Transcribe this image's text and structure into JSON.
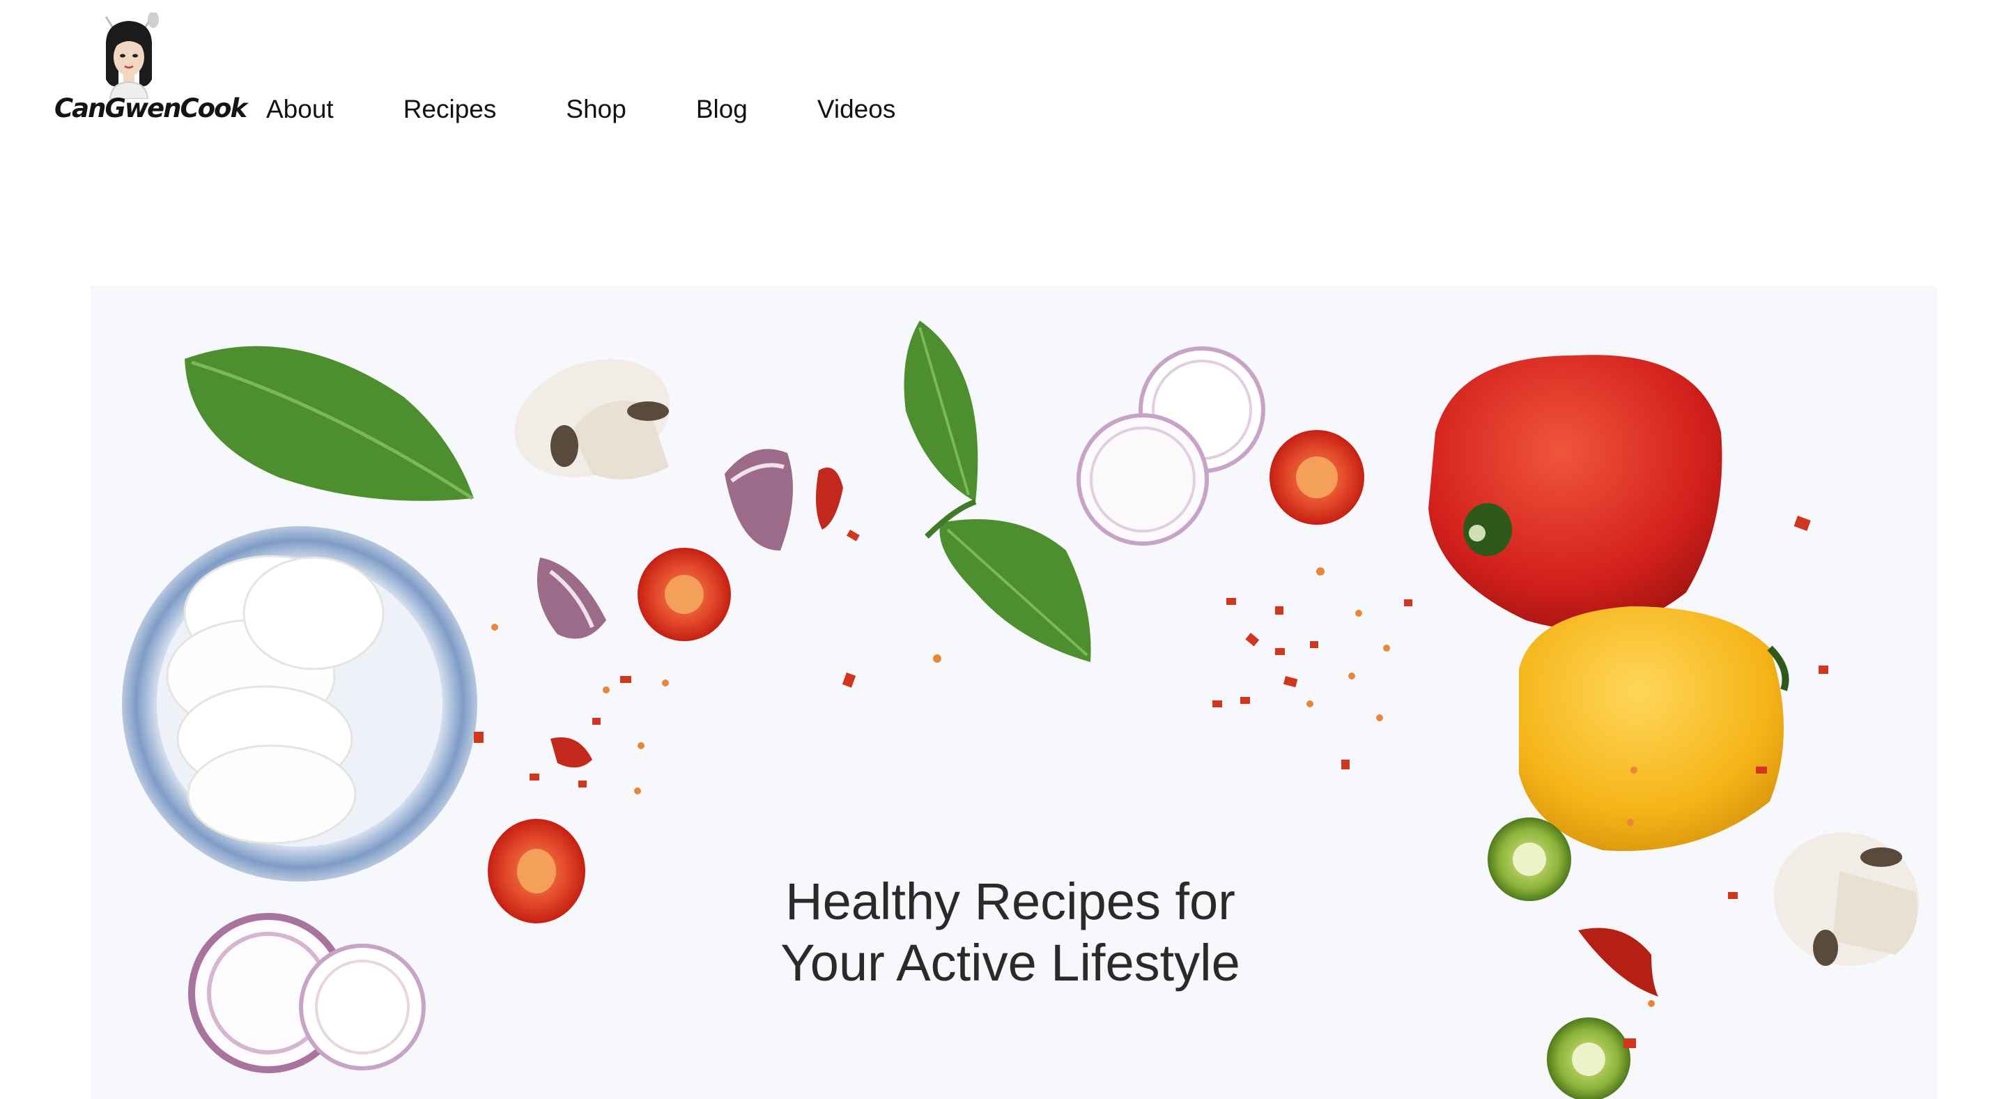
{
  "brand": {
    "name": "CanGwenCook",
    "logo_icon": "chef-avatar-icon"
  },
  "nav": {
    "items": [
      {
        "label": "About"
      },
      {
        "label": "Recipes"
      },
      {
        "label": "Shop"
      },
      {
        "label": "Blog"
      },
      {
        "label": "Videos"
      }
    ]
  },
  "hero": {
    "headline_line1": "Healthy Recipes for",
    "headline_line2": "Your Active Lifestyle",
    "image_description_icons": [
      "basil-leaf-icon",
      "mushroom-icon",
      "garlic-icon",
      "chili-flakes-icon",
      "cherry-tomato-icon",
      "onion-ring-icon",
      "red-pepper-icon",
      "yellow-pepper-icon",
      "mozzarella-bowl-icon",
      "green-tomato-icon"
    ]
  },
  "colors": {
    "background": "#ffffff",
    "text": "#1a1a1a",
    "headline": "#2a2a2a",
    "basil": "#4a8f2e",
    "tomato": "#d9301f",
    "red_pepper": "#d8231e",
    "yellow_pepper": "#f5b51b",
    "onion": "#b48aa8",
    "bowl": "#8aa4c8"
  }
}
